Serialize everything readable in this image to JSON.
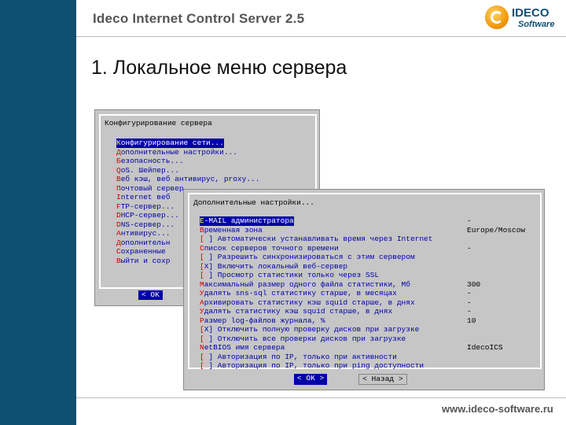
{
  "header": {
    "title": "Ideco Internet Control Server 2.5",
    "logo_line1": "IDECO",
    "logo_line2": "Software"
  },
  "slide_title": "1. Локальное меню сервера",
  "footer_url": "www.ideco-software.ru",
  "window1": {
    "title": "Конфигурирование сервера",
    "items": [
      {
        "hot": "К",
        "rest": "онфигурирование сети..."
      },
      {
        "hot": "Д",
        "rest": "ополнительные настройки..."
      },
      {
        "hot": "Б",
        "rest": "езопасность..."
      },
      {
        "hot": "Q",
        "rest": "oS. Шейпер..."
      },
      {
        "hot": "В",
        "rest": "еб кэш, веб антивирус, proxy..."
      },
      {
        "hot": "П",
        "rest": "очтовый сервер"
      },
      {
        "hot": "I",
        "rest": "nternet веб"
      },
      {
        "hot": "F",
        "rest": "TP-сервер..."
      },
      {
        "hot": "D",
        "rest": "HCP-сервер..."
      },
      {
        "hot": "D",
        "rest": "NS-сервер..."
      },
      {
        "hot": "А",
        "rest": "нтивирус..."
      },
      {
        "hot": "Д",
        "rest": "ополнительн"
      },
      {
        "hot": "С",
        "rest": "охраненные"
      },
      {
        "hot": "В",
        "rest": "ыйти и сохр"
      }
    ],
    "ok_label": "< OK"
  },
  "window2": {
    "title": "Дополнительные настройки...",
    "items": [
      {
        "hot": "E",
        "rest": "-MAIL администратора"
      },
      {
        "hot": "В",
        "rest": "ременная зона"
      },
      {
        "hot": "[",
        "rest": " ] Автоматически устанавливать время через Internet"
      },
      {
        "hot": "С",
        "rest": "писок серверов точного времени"
      },
      {
        "hot": "[",
        "rest": " ] Разрешить синхронизироваться с этим сервером"
      },
      {
        "hot": "[",
        "rest": "X] Включить локальный веб-сервер"
      },
      {
        "hot": "[",
        "rest": " ] Просмотр статистики только через SSL"
      },
      {
        "hot": "М",
        "rest": "аксимальный размер одного файла статистики, Мб"
      },
      {
        "hot": "У",
        "rest": "далять sns-sql статистику старше, в месяцах"
      },
      {
        "hot": "А",
        "rest": "рхивировать статистику кэш squid старше, в днях"
      },
      {
        "hot": "У",
        "rest": "далять статистику кэш squid старше, в днях"
      },
      {
        "hot": "Р",
        "rest": "азмер log-файлов журнала, %"
      },
      {
        "hot": "[",
        "rest": "X] Отключить полную проверку дисков при загрузке"
      },
      {
        "hot": "[",
        "rest": " ] Отключить все проверки дисков при загрузке"
      },
      {
        "hot": "N",
        "rest": "etBIOS имя сервера"
      },
      {
        "hot": "[",
        "rest": " ] Авторизация по IP, только при активности"
      },
      {
        "hot": "[",
        "rest": " ] Авторизация по IP, только при ping доступности"
      }
    ],
    "values": [
      "-",
      "Europe/Moscow",
      "",
      "-",
      "",
      "",
      "",
      "300",
      "-",
      "-",
      "-",
      "10",
      "",
      "",
      "IdecoICS",
      "",
      ""
    ],
    "ok_label": "< OK >",
    "back_label": "< Назад >"
  }
}
